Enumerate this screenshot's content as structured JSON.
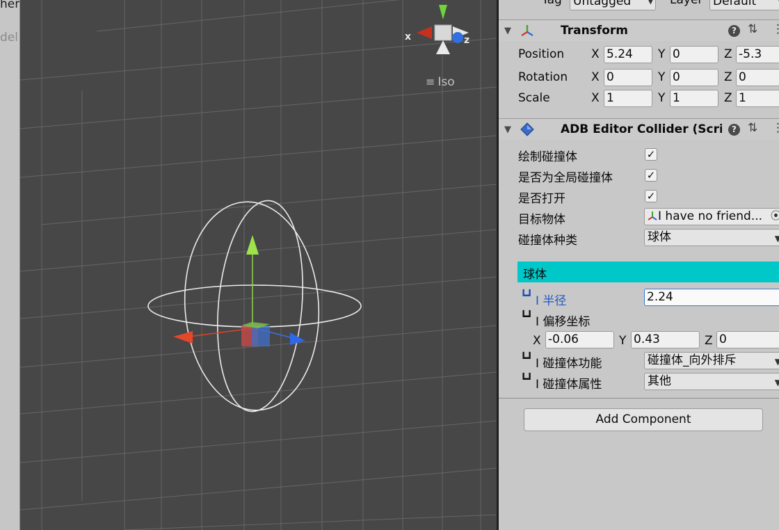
{
  "left_panel": {
    "text_top": "her",
    "text_mid": "del"
  },
  "scene": {
    "projection_label": "Iso",
    "axis_x_label": "x",
    "axis_z_label": "z"
  },
  "inspector": {
    "top_row": {
      "tag_label": "Tag",
      "tag_value": "Untagged",
      "layer_label": "Layer",
      "layer_value": "Default"
    },
    "transform": {
      "title": "Transform",
      "rows": [
        {
          "label": "Position",
          "x": "5.24",
          "y": "0",
          "z": "-5.3"
        },
        {
          "label": "Rotation",
          "x": "0",
          "y": "0",
          "z": "0"
        },
        {
          "label": "Scale",
          "x": "1",
          "y": "1",
          "z": "1"
        }
      ],
      "axis_x": "X",
      "axis_y": "Y",
      "axis_z": "Z"
    },
    "collider": {
      "title": "ADB Editor Collider (Scrip",
      "draw_label": "绘制碰撞体",
      "draw_checked": true,
      "global_label": "是否为全局碰撞体",
      "global_checked": true,
      "open_label": "是否打开",
      "open_checked": true,
      "target_label": "目标物体",
      "target_value": "I have no friend...",
      "type_label": "碰撞体种类",
      "type_value": "球体",
      "section_title": "球体",
      "radius_label": "半径",
      "radius_value": "2.24",
      "offset_label": "偏移坐标",
      "offset_x": "-0.06",
      "offset_y": "0.43",
      "offset_z": "0",
      "function_label": "碰撞体功能",
      "function_value": "碰撞体_向外排斥",
      "attribute_label": "碰撞体属性",
      "attribute_value": "其他",
      "tree_prefix": "┗┛"
    },
    "add_component_label": "Add Component"
  },
  "colors": {
    "section_accent": "#00c8c8",
    "scene_bg": "#474747",
    "focus_border": "#3a79d7"
  }
}
